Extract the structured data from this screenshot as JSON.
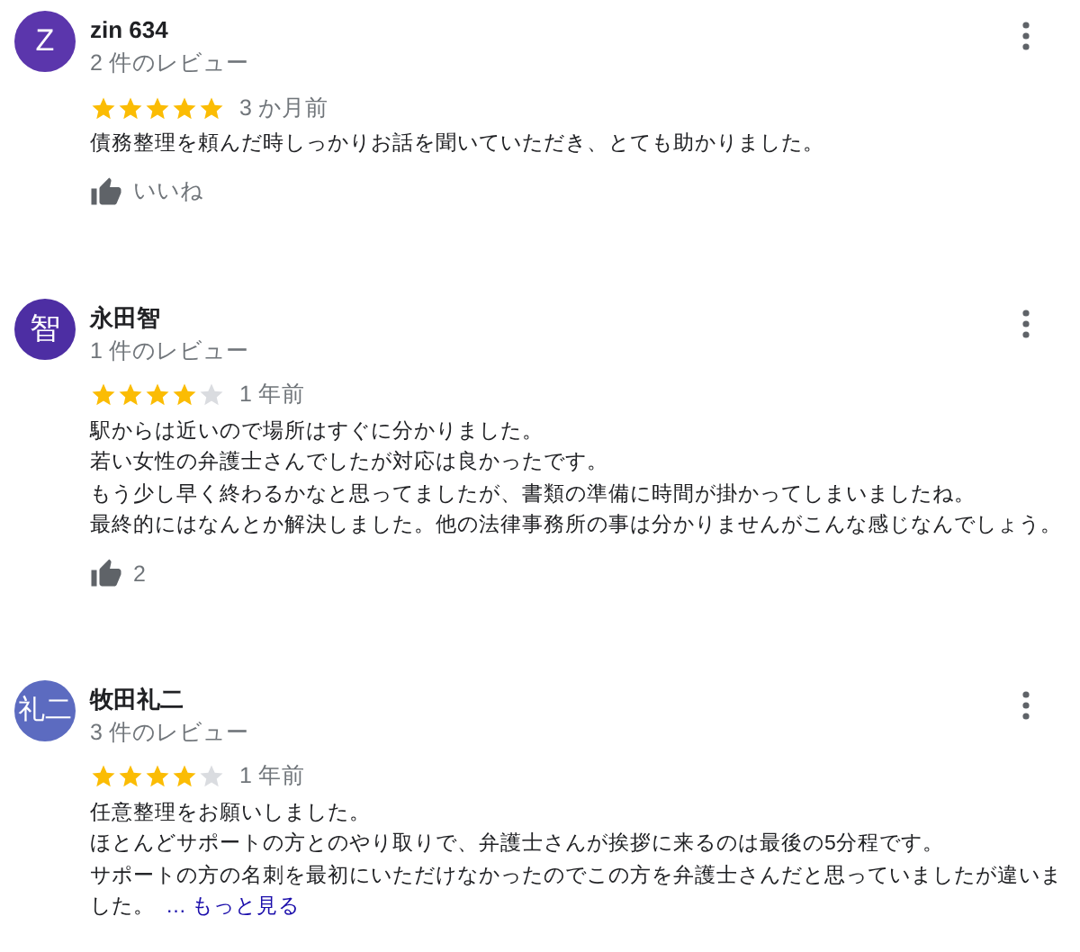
{
  "reviews": [
    {
      "avatar": {
        "initial": "Z",
        "color": "#5b36ac"
      },
      "name": "zin 634",
      "review_count": "2 件のレビュー",
      "stars": 5,
      "time": "3 か月前",
      "text_lines": [
        "債務整理を頼んだ時しっかりお話を聞いていただき、とても助かりました。"
      ],
      "like": {
        "label": "いいね"
      }
    },
    {
      "avatar": {
        "initial": "智",
        "color": "#4d2ea3"
      },
      "name": "永田智",
      "review_count": "1 件のレビュー",
      "stars": 4,
      "time": "1 年前",
      "text_lines": [
        "駅からは近いので場所はすぐに分かりました。",
        "若い女性の弁護士さんでしたが対応は良かったです。",
        "もう少し早く終わるかなと思ってましたが、書類の準備に時間が掛かってしまいましたね。",
        "最終的にはなんとか解決しました。他の法律事務所の事は分かりませんがこんな感じなんでしょう。"
      ],
      "like": {
        "label": "2"
      }
    },
    {
      "avatar": {
        "initial": "礼二",
        "color": "#5c6bc0"
      },
      "name": "牧田礼二",
      "review_count": "3 件のレビュー",
      "stars": 4,
      "time": "1 年前",
      "text_lines": [
        "任意整理をお願いしました。",
        "ほとんどサポートの方とのやり取りで、弁護士さんが挨拶に来るのは最後の5分程です。",
        "サポートの方の名刺を最初にいただけなかったのでこの方を弁護士さんだと思っていましたが違いま",
        "した。"
      ],
      "more_link": "… もっと見る"
    }
  ]
}
